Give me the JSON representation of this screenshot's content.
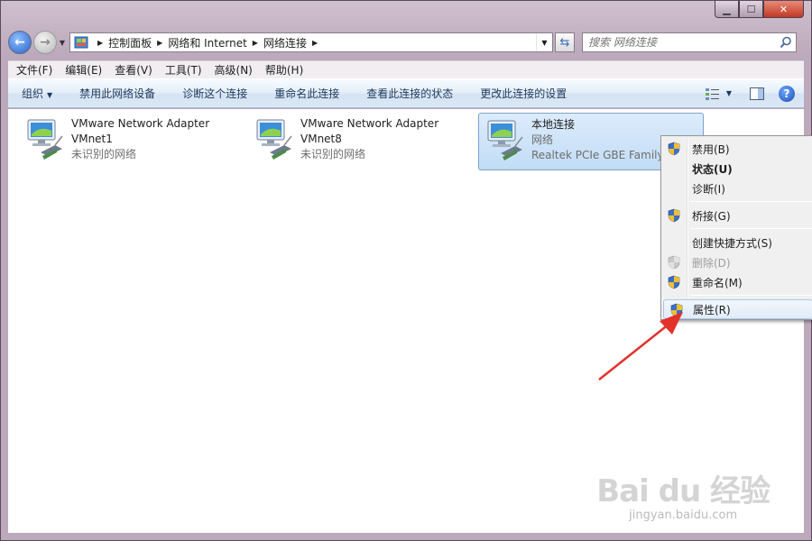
{
  "window": {
    "colors": {
      "accent": "#2860c8",
      "close": "#c13a24",
      "selection": "#c2dcf5",
      "arrow": "#e3312a"
    }
  },
  "address_bar": {
    "crumbs": [
      "控制面板",
      "网络和 Internet",
      "网络连接"
    ],
    "search_placeholder": "搜索 网络连接"
  },
  "menubar": {
    "items": [
      "文件(F)",
      "编辑(E)",
      "查看(V)",
      "工具(T)",
      "高级(N)",
      "帮助(H)"
    ]
  },
  "commandbar": {
    "items": [
      "组织",
      "禁用此网络设备",
      "诊断这个连接",
      "重命名此连接",
      "查看此连接的状态",
      "更改此连接的设置"
    ]
  },
  "connections": [
    {
      "name": "VMware Network Adapter",
      "sub": "VMnet1",
      "status": "未识别的网络"
    },
    {
      "name": "VMware Network Adapter",
      "sub": "VMnet8",
      "status": "未识别的网络"
    },
    {
      "name": "本地连接",
      "sub": "网络",
      "status": "Realtek PCIe GBE Family"
    }
  ],
  "context_menu": {
    "items": [
      "禁用(B)",
      "状态(U)",
      "诊断(I)",
      "桥接(G)",
      "创建快捷方式(S)",
      "删除(D)",
      "重命名(M)",
      "属性(R)"
    ]
  },
  "watermark": {
    "brand": "Bai du 经验",
    "url": "jingyan.baidu.com"
  }
}
